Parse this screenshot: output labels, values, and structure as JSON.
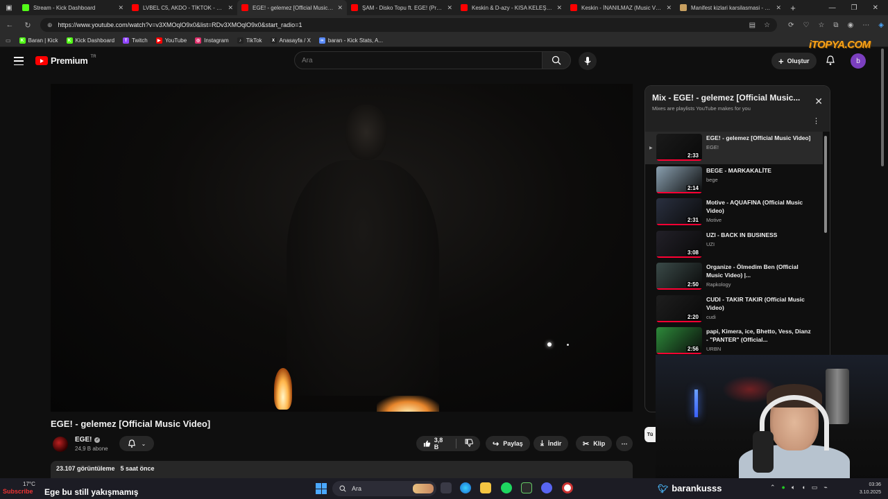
{
  "browser": {
    "tabs": [
      {
        "title": "Stream - Kick Dashboard",
        "icon": "kick",
        "color": "#53fc18",
        "active": false
      },
      {
        "title": "LVBEL C5, AKDO - TİKTOK - YouTube",
        "icon": "youtube",
        "color": "#ff0000",
        "active": false
      },
      {
        "title": "EGE! - gelemez [Official Music Video]",
        "icon": "youtube",
        "color": "#ff0000",
        "active": true
      },
      {
        "title": "ŞAM - Disko Topu ft. EGE! (Prod...)",
        "icon": "youtube",
        "color": "#ff0000",
        "active": false
      },
      {
        "title": "Keskin & D-azy - KISA KELEŞ II (M...)",
        "icon": "youtube",
        "color": "#ff0000",
        "active": false
      },
      {
        "title": "Keskin - İNANILMAZ (Music Video)",
        "icon": "youtube",
        "color": "#ff0000",
        "active": false
      },
      {
        "title": "Manifest kizlari karsilasmasi - Qu...",
        "icon": "web",
        "color": "#c8a060",
        "active": false
      }
    ],
    "url": "https://www.youtube.com/watch?v=v3XMOqlO9x0&list=RDv3XMOqlO9x0&start_radio=1",
    "bookmarks": [
      {
        "label": "Baran | Kick",
        "icon": "K",
        "color": "#53fc18"
      },
      {
        "label": "Kick Dashboard",
        "icon": "K",
        "color": "#53fc18"
      },
      {
        "label": "Twitch",
        "icon": "T",
        "color": "#9146ff"
      },
      {
        "label": "YouTube",
        "icon": "▶",
        "color": "#ff0000"
      },
      {
        "label": "Instagram",
        "icon": "◎",
        "color": "#e1306c"
      },
      {
        "label": "TikTok",
        "icon": "♪",
        "color": "#222222"
      },
      {
        "label": "Anasayfa / X",
        "icon": "X",
        "color": "#222222"
      },
      {
        "label": "baran - Kick Stats, A...",
        "icon": "∞",
        "color": "#5b8cff"
      }
    ]
  },
  "youtube": {
    "logo_text": "Premium",
    "logo_region": "TR",
    "search_placeholder": "Ara",
    "create_label": "Oluştur",
    "avatar_letter": "b"
  },
  "video": {
    "title": "EGE! - gelemez [Official Music Video]",
    "channel": "EGE!",
    "subscribers": "24,9 B abone",
    "likes": "3,8 B",
    "share_label": "Paylaş",
    "download_label": "İndir",
    "clip_label": "Klip",
    "views": "23.107 görüntüleme",
    "published": "5 saat önce"
  },
  "mix": {
    "title": "Mix - EGE! - gelemez [Official Music...",
    "subtitle": "Mixes are playlists YouTube makes for you",
    "items": [
      {
        "title": "EGE! - gelemez [Official Music Video]",
        "channel": "EGE!",
        "duration": "2:33",
        "active": true,
        "thumb": "#1a1a1a"
      },
      {
        "title": "BEGE - MARKAKALİTE",
        "channel": "bege",
        "duration": "2:14",
        "active": false,
        "thumb": "#8aa0b0"
      },
      {
        "title": "Motive - AQUAFINA (Official Music Video)",
        "channel": "Motive",
        "duration": "2:31",
        "active": false,
        "thumb": "#2a3040"
      },
      {
        "title": "UZI - BACK IN BUSINESS",
        "channel": "UZI",
        "duration": "3:08",
        "active": false,
        "thumb": "#222028"
      },
      {
        "title": "Organize - Ölmedim Ben (Official Music Video) |...",
        "channel": "Rapkology",
        "duration": "2:50",
        "active": false,
        "thumb": "#3a4a48"
      },
      {
        "title": "CUDI - TAKIR TAKIR (Official Music Video)",
        "channel": "cudi",
        "duration": "2:20",
        "active": false,
        "thumb": "#1e1e1e"
      },
      {
        "title": "papi, Kimera, ice, Bhetto, Vess, Dianz - \"PANTER\" (Official...",
        "channel": "URBN",
        "duration": "2:56",
        "active": false,
        "thumb": "#2d8a3a"
      }
    ]
  },
  "overlay": {
    "watermark": "iTOPYA.COM",
    "streamer_handle": "barankusss",
    "chat_prefix": "Subscribe",
    "chat_message": "Ege bu still yakışmamış"
  },
  "side_chip": "Tü",
  "taskbar": {
    "temperature": "17°C",
    "search_label": "Ara",
    "time": "03:36",
    "date": "3.10.2025"
  }
}
